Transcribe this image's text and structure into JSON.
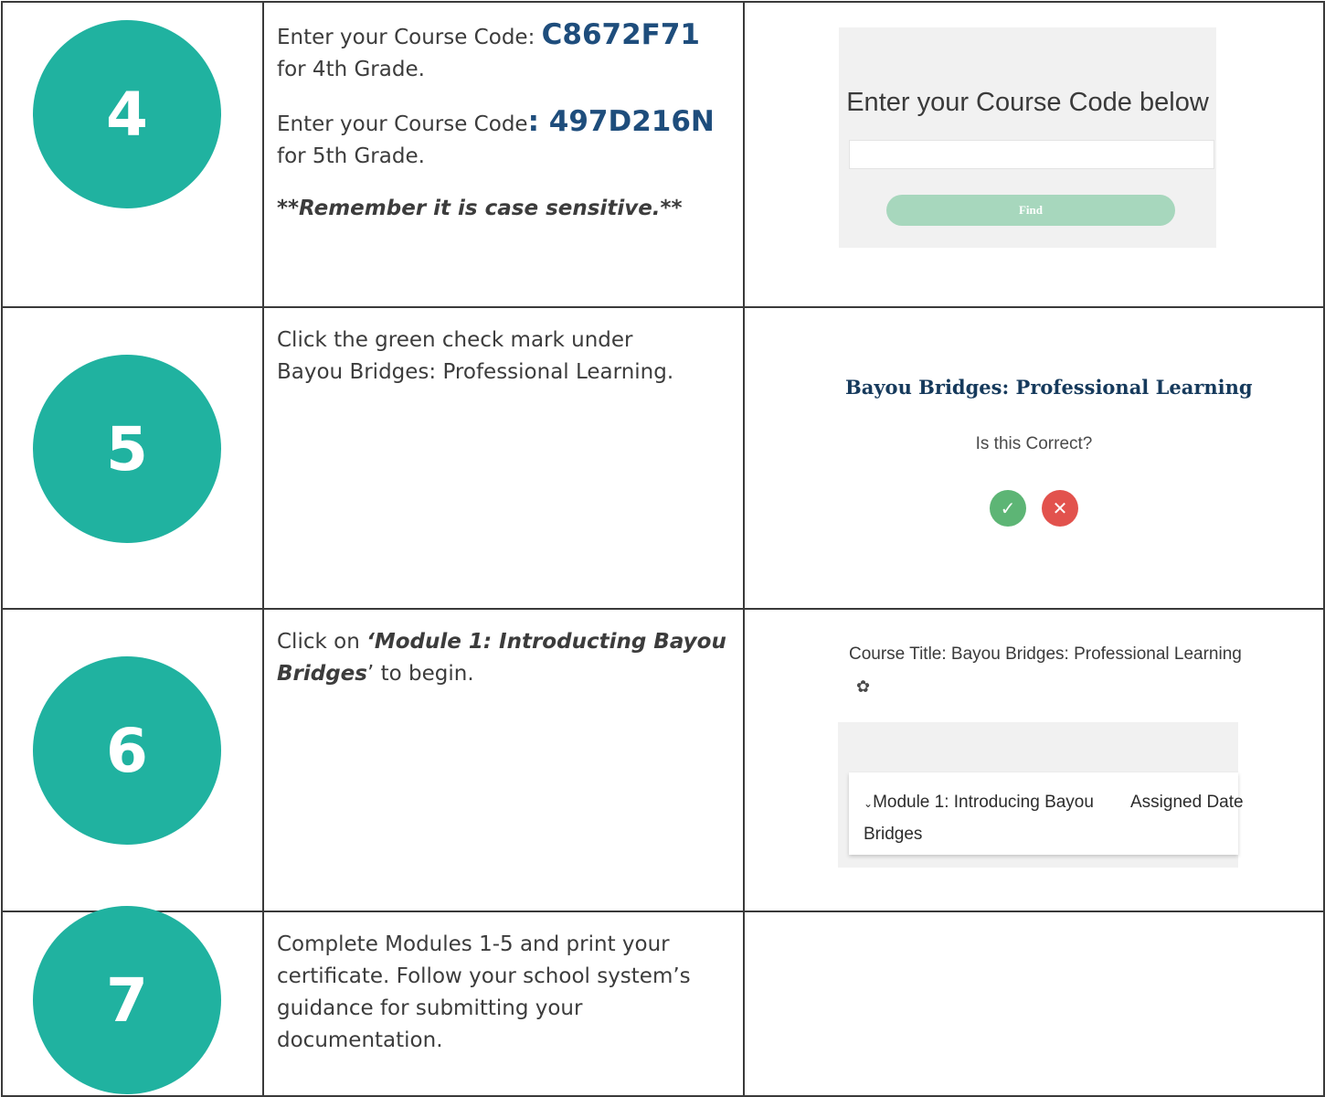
{
  "steps": {
    "s4": {
      "number": "4",
      "line1_prefix": "Enter your Course Code: ",
      "code1": "C8672F71",
      "line1_suffix": "for 4th Grade.",
      "line2_prefix": "Enter your Course Code",
      "code2": ": 497D216N",
      "line2_suffix": "for 5th Grade.",
      "note": "**Remember it is case sensitive.**",
      "shot": {
        "heading": "Enter your Course Code below",
        "input_value": "",
        "button_label": "Find"
      }
    },
    "s5": {
      "number": "5",
      "text": "Click the green check mark under Bayou Bridges: Professional Learning.",
      "shot": {
        "title": "Bayou Bridges: Professional Learning",
        "question": "Is this Correct?",
        "confirm_icon": "✓",
        "cancel_icon": "✕"
      }
    },
    "s6": {
      "number": "6",
      "prefix": "Click on ",
      "link": "‘Module 1: Introducting Bayou Bridges",
      "suffix": "’ to begin.",
      "shot": {
        "course_title": "Course Title: Bayou Bridges: Professional Learning",
        "gear_icon": "✿",
        "chevron_icon": "⌄",
        "module": "Module 1: Introducing Bayou Bridges",
        "assigned": "Assigned Date"
      }
    },
    "s7": {
      "number": "7",
      "text": "Complete Modules 1-5 and print your certificate. Follow your school system’s guidance for submitting your documentation."
    }
  },
  "colors": {
    "accent_circle": "#20b2a0",
    "code_blue": "#1e4d7c",
    "confirm_green": "#5db575",
    "cancel_red": "#e2524d",
    "find_button": "#a7d7bd"
  }
}
